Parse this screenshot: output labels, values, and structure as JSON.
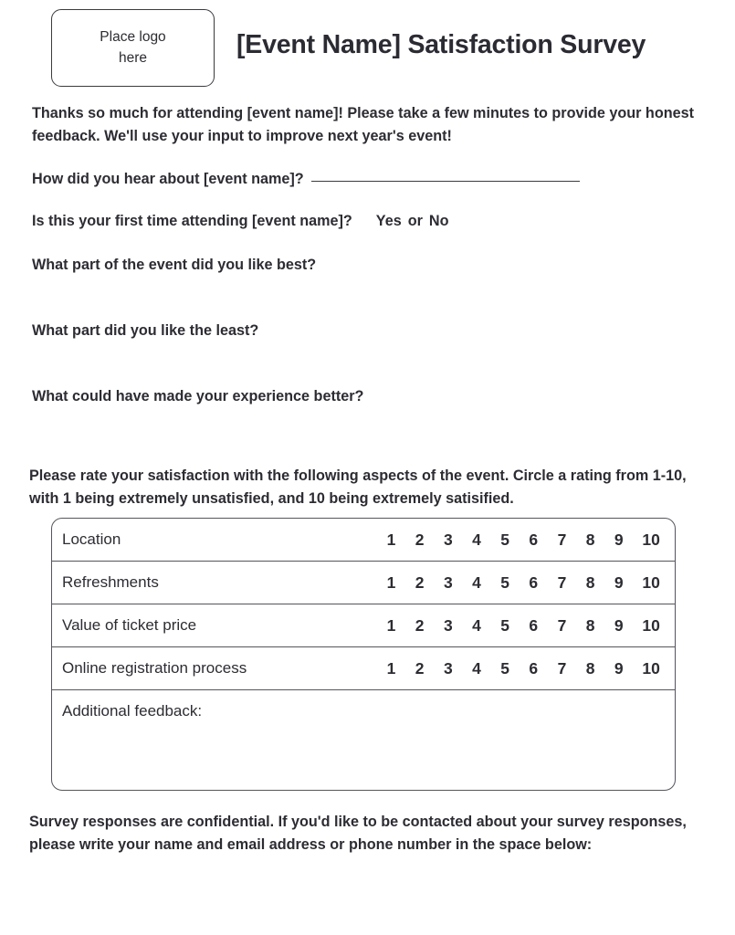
{
  "header": {
    "logo_placeholder": "Place logo\nhere",
    "title": "[Event Name] Satisfaction Survey"
  },
  "intro": {
    "text": "Thanks so much for attending [event name]! Please take a few minutes to provide your honest feedback. We'll use your input to improve next year's event!"
  },
  "questions": {
    "hear_about": "How did you hear about [event name]?",
    "first_time": "Is this your first time attending [event name]?",
    "yes_label": "Yes",
    "or_label": "or",
    "no_label": "No",
    "like_best": "What part of the event did you like best?",
    "like_least": "What part did you like the least?",
    "experience_better": "What could have made your experience better?"
  },
  "rating_section": {
    "instructions": "Please rate your satisfaction with the following aspects of the event. Circle a rating from 1-10, with 1 being extremely unsatisfied, and 10 being extremely satisified.",
    "scale": [
      "1",
      "2",
      "3",
      "4",
      "5",
      "6",
      "7",
      "8",
      "9",
      "10"
    ],
    "rows": [
      {
        "label": "Location"
      },
      {
        "label": "Refreshments"
      },
      {
        "label": "Value of ticket price"
      },
      {
        "label": "Online registration process"
      }
    ],
    "feedback_label": "Additional feedback:"
  },
  "footer": {
    "text": "Survey responses are confidential. If you'd like to be contacted about your survey responses, please write your name and email address or phone number in the space below:"
  },
  "colors": {
    "text": "#2c2c33",
    "border": "#55555c",
    "logo_border": "#3a3a40",
    "background": "#ffffff"
  }
}
